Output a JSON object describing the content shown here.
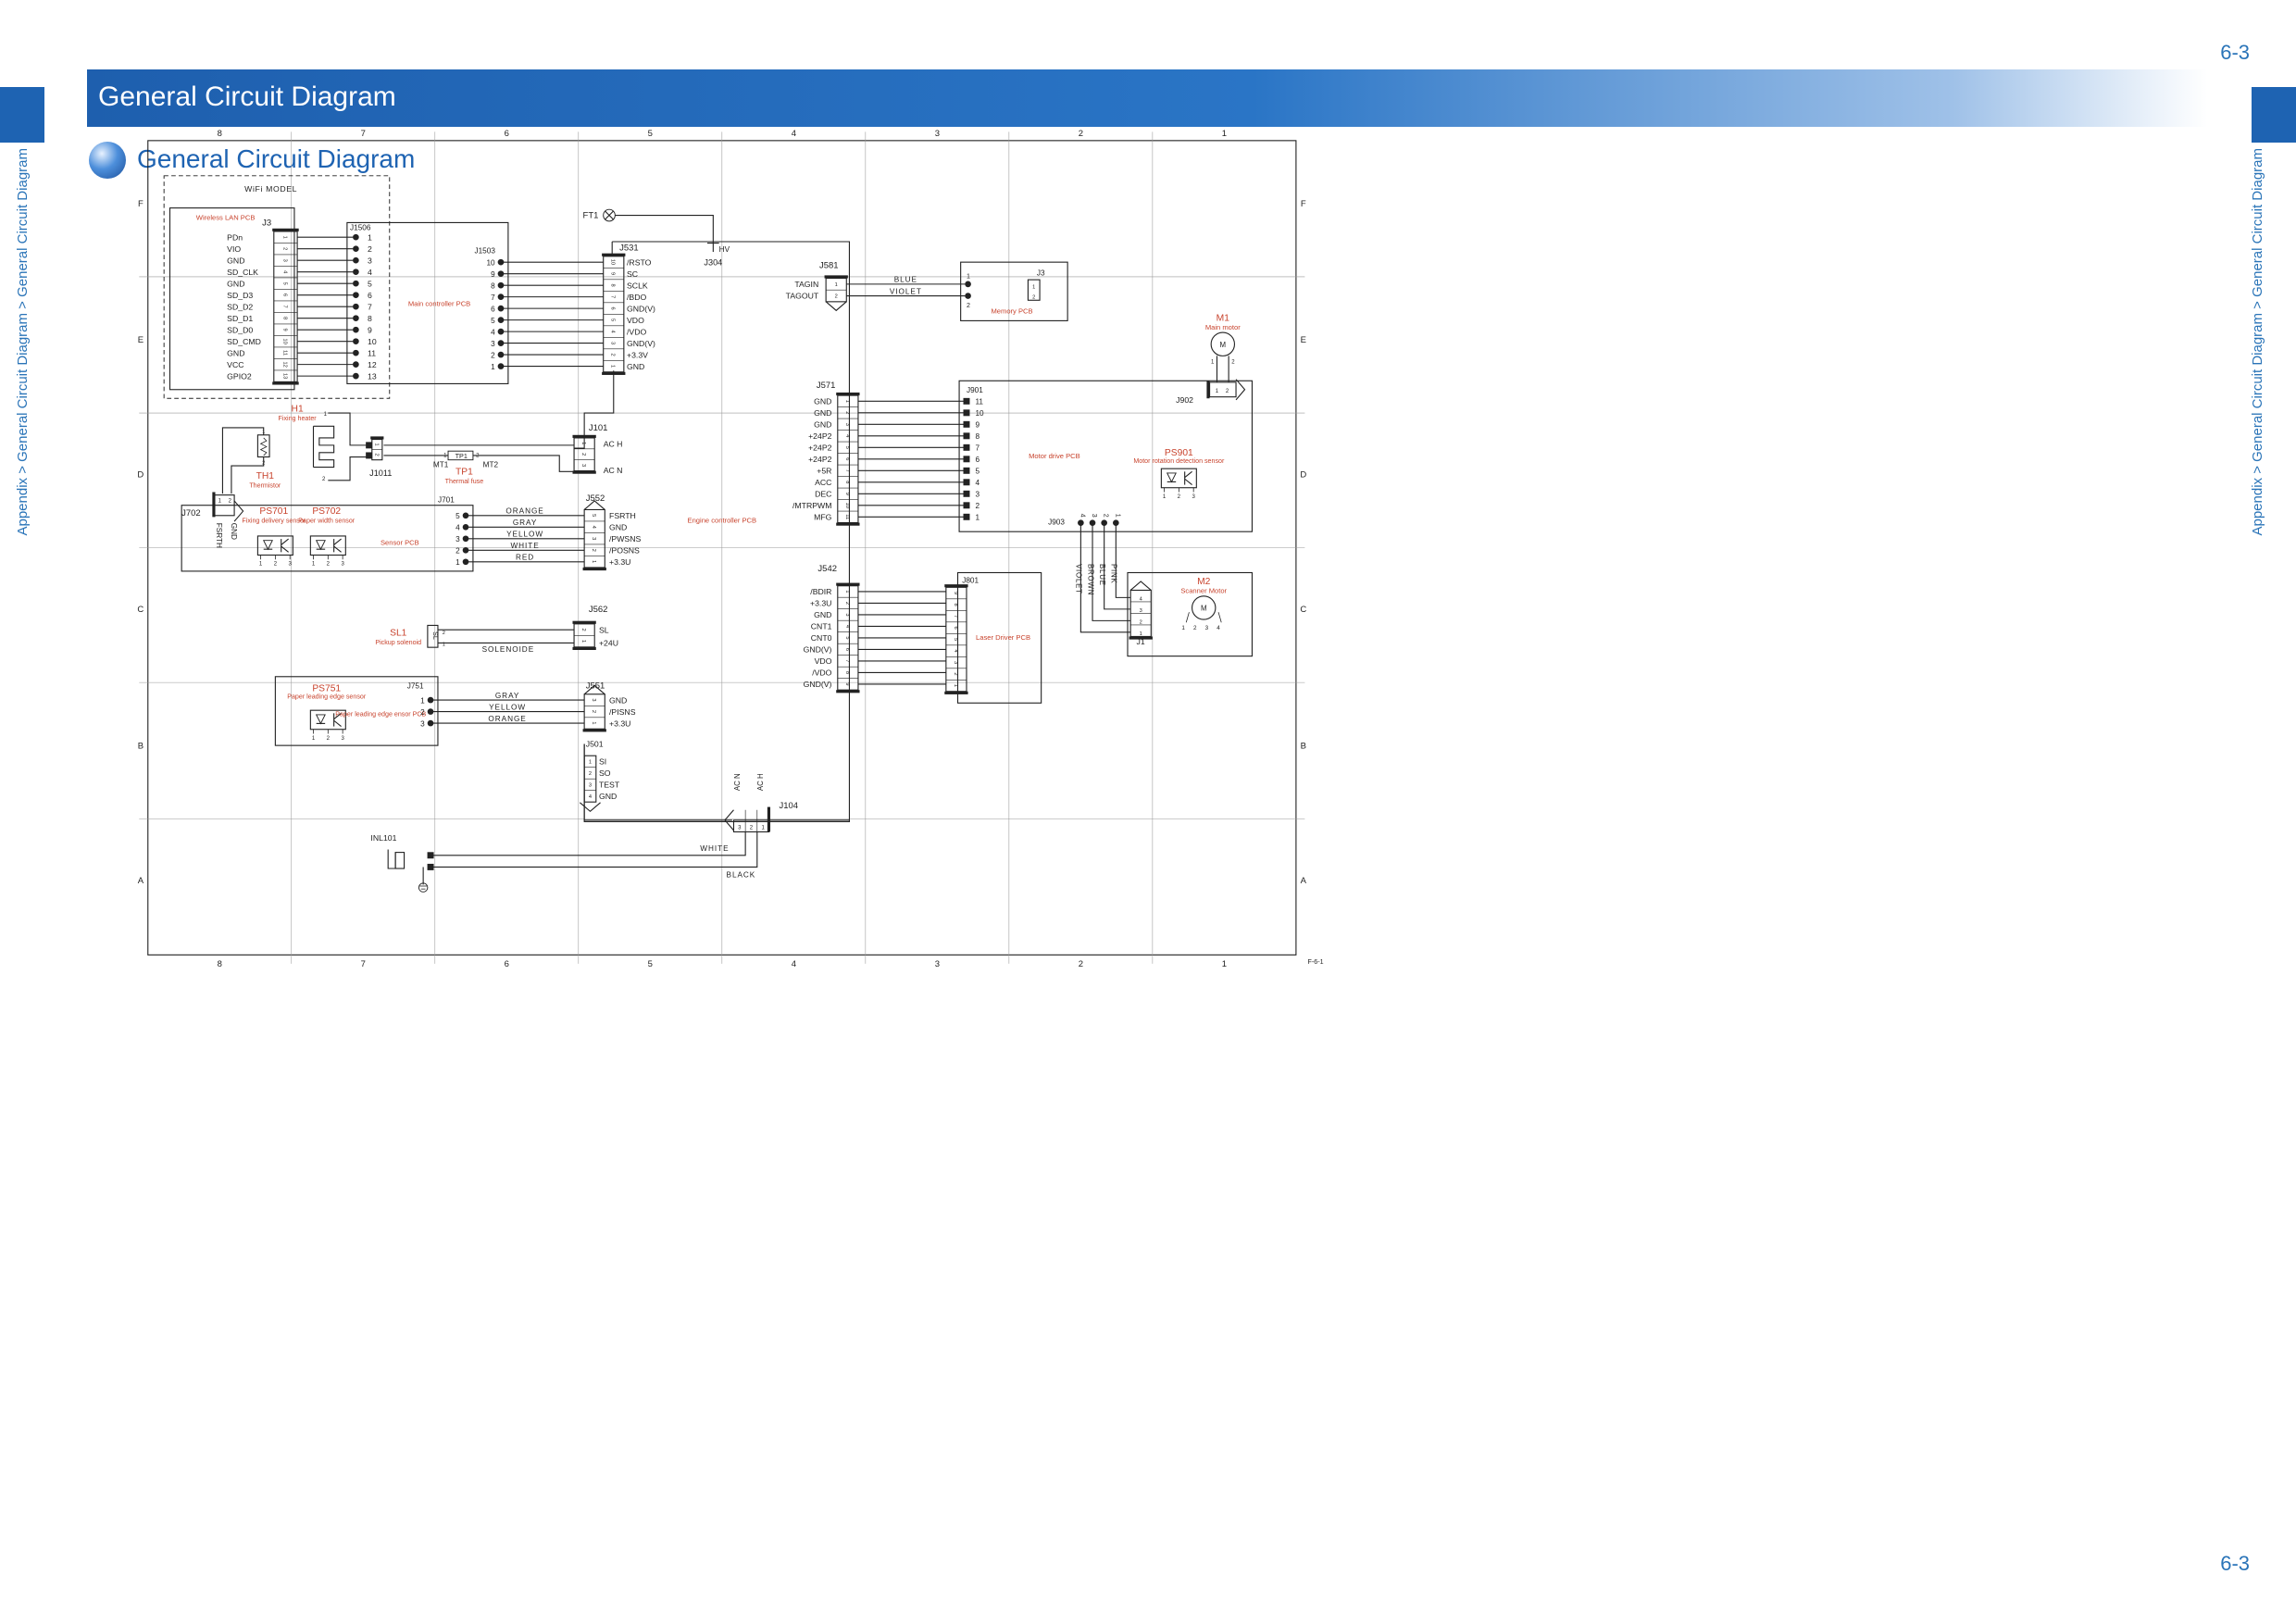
{
  "page": {
    "number": "6-3",
    "title": "General Circuit Diagram",
    "section": "General Circuit Diagram",
    "breadcrumb": "Appendix > General Circuit Diagram > General Circuit Diagram",
    "figure_id": "F-6-1"
  },
  "grid": {
    "cols": [
      "8",
      "7",
      "6",
      "5",
      "4",
      "3",
      "2",
      "1"
    ],
    "rows": [
      "F",
      "E",
      "D",
      "C",
      "B",
      "A"
    ]
  },
  "wifi": {
    "title": "WiFi MODEL",
    "pcb": "Wireless LAN PCB",
    "conn": "J3",
    "conn2": "J1506",
    "signals": [
      "PDn",
      "VIO",
      "GND",
      "SD_CLK",
      "GND",
      "SD_D3",
      "SD_D2",
      "SD_D1",
      "SD_D0",
      "SD_CMD",
      "GND",
      "VCC",
      "GPIO2"
    ],
    "pins": [
      "1",
      "2",
      "3",
      "4",
      "5",
      "6",
      "7",
      "8",
      "9",
      "10",
      "11",
      "12",
      "13"
    ]
  },
  "main_ctrl": {
    "label": "Main controller PCB",
    "conn": "J1503",
    "pins": [
      "10",
      "9",
      "8",
      "7",
      "6",
      "5",
      "4",
      "3",
      "2",
      "1"
    ]
  },
  "j531": {
    "name": "J531",
    "signals": [
      "/RSTO",
      "SC",
      "SCLK",
      "/BDO",
      "GND(V)",
      "VDO",
      "/VDO",
      "GND(V)",
      "+3.3V",
      "GND"
    ],
    "pins": [
      "10",
      "9",
      "8",
      "7",
      "6",
      "5",
      "4",
      "3",
      "2",
      "1"
    ]
  },
  "ft1": {
    "name": "FT1",
    "hv": "HV",
    "j304": "J304"
  },
  "j581": {
    "name": "J581",
    "signals": [
      "TAGIN",
      "TAGOUT"
    ],
    "pins": [
      "1",
      "2"
    ],
    "wires": [
      "BLUE",
      "VIOLET"
    ]
  },
  "memory": {
    "conn": "J3",
    "label": "Memory PCB",
    "pins": [
      "1",
      "2"
    ],
    "inner": [
      "1",
      "2"
    ]
  },
  "m1": {
    "name": "M1",
    "label": "Main motor",
    "symbol": "M",
    "pins": [
      "1",
      "2"
    ]
  },
  "j571": {
    "name": "J571",
    "signals": [
      "GND",
      "GND",
      "GND",
      "+24P2",
      "+24P2",
      "+24P2",
      "+5R",
      "ACC",
      "DEC",
      "/MTRPWM",
      "MFG"
    ],
    "pins": [
      "1",
      "2",
      "3",
      "4",
      "5",
      "6",
      "7",
      "8",
      "9",
      "10",
      "11"
    ]
  },
  "motor_drive": {
    "label": "Motor drive PCB",
    "conn": "J901",
    "pins": [
      "11",
      "10",
      "9",
      "8",
      "7",
      "6",
      "5",
      "4",
      "3",
      "2",
      "1"
    ],
    "j902": "J902",
    "j902_pins": [
      "1",
      "2"
    ],
    "j903": "J903",
    "j903_pins": [
      "4",
      "3",
      "2",
      "1"
    ]
  },
  "ps901": {
    "name": "PS901",
    "label": "Motor rotation detection sensor",
    "pins": [
      "1",
      "2",
      "3"
    ]
  },
  "h1": {
    "name": "H1",
    "label": "Fixing heater",
    "pins": [
      "1",
      "2"
    ]
  },
  "j1011": {
    "name": "J1011",
    "pins": [
      "1",
      "2"
    ]
  },
  "j101": {
    "name": "J101",
    "signals": [
      "AC H",
      "AC N"
    ],
    "pins": [
      "1",
      "2",
      "3"
    ]
  },
  "tp1": {
    "name": "TP1",
    "label": "Thermal fuse",
    "symbol": "TP1",
    "mt1": "MT1",
    "mt2": "MT2",
    "pins": [
      "1",
      "2"
    ]
  },
  "th1": {
    "name": "TH1",
    "label": "Thermistor",
    "pins": [
      "1",
      "2"
    ]
  },
  "sensor_pcb": {
    "label": "Sensor PCB",
    "j702": "J702",
    "j702_pins": [
      "1",
      "2"
    ],
    "j702_signals": [
      "FSRTH",
      "GND"
    ],
    "j701": "J701",
    "pins": [
      "5",
      "4",
      "3",
      "2",
      "1"
    ],
    "wires": [
      "ORANGE",
      "GRAY",
      "YELLOW",
      "WHITE",
      "RED"
    ]
  },
  "ps701": {
    "name": "PS701",
    "label": "Fixing delivery sensor",
    "pins": [
      "1",
      "2",
      "3"
    ]
  },
  "ps702": {
    "name": "PS702",
    "label": "Paper width sensor",
    "pins": [
      "1",
      "2",
      "3"
    ]
  },
  "j552": {
    "name": "J552",
    "signals": [
      "FSRTH",
      "GND",
      "/PWSNS",
      "/POSNS",
      "+3.3U"
    ],
    "pins": [
      "5",
      "4",
      "3",
      "2",
      "1"
    ]
  },
  "engine": {
    "label": "Engine controller PCB"
  },
  "j542": {
    "name": "J542",
    "signals": [
      "/BDIR",
      "+3.3U",
      "GND",
      "CNT1",
      "CNT0",
      "GND(V)",
      "VDO",
      "/VDO",
      "GND(V)"
    ],
    "pins": [
      "1",
      "2",
      "3",
      "4",
      "5",
      "6",
      "7",
      "8",
      "9"
    ]
  },
  "laser": {
    "label": "Laser Driver PCB",
    "conn": "J801",
    "pins": [
      "9",
      "8",
      "7",
      "6",
      "5",
      "4",
      "3",
      "2",
      "1"
    ]
  },
  "m2": {
    "name": "M2",
    "label": "Scanner Motor",
    "symbol": "M",
    "conn": "J1",
    "pins": [
      "1",
      "2",
      "3",
      "4"
    ],
    "wires": [
      "VIOLET",
      "BROWN",
      "BLUE",
      "PINK"
    ]
  },
  "sl1": {
    "name": "SL1",
    "label": "Pickup solenoid",
    "symbol": "SL",
    "pins": [
      "2",
      "1"
    ],
    "wire": "SOLENOIDE"
  },
  "j562": {
    "name": "J562",
    "signals": [
      "SL",
      "+24U"
    ],
    "pins": [
      "2",
      "1"
    ]
  },
  "ps751": {
    "name": "PS751",
    "label": "Paper leading edge sensor",
    "pcb": "Paper leading edge ensor PCB",
    "conn": "J751",
    "pins": [
      "1",
      "2",
      "3"
    ],
    "sensor_pins": [
      "1",
      "2",
      "3"
    ],
    "wires": [
      "GRAY",
      "YELLOW",
      "ORANGE"
    ]
  },
  "j551": {
    "name": "J551",
    "signals": [
      "GND",
      "/PISNS",
      "+3.3U"
    ],
    "pins": [
      "3",
      "2",
      "1"
    ]
  },
  "j501": {
    "name": "J501",
    "signals": [
      "SI",
      "SO",
      "TEST",
      "GND"
    ],
    "pins": [
      "1",
      "2",
      "3",
      "4"
    ]
  },
  "j104": {
    "name": "J104",
    "pins": [
      "3",
      "2",
      "1"
    ],
    "signals": [
      "AC N",
      "AC H"
    ]
  },
  "inl101": {
    "name": "INL101",
    "wires": [
      "WHITE",
      "BLACK"
    ]
  }
}
